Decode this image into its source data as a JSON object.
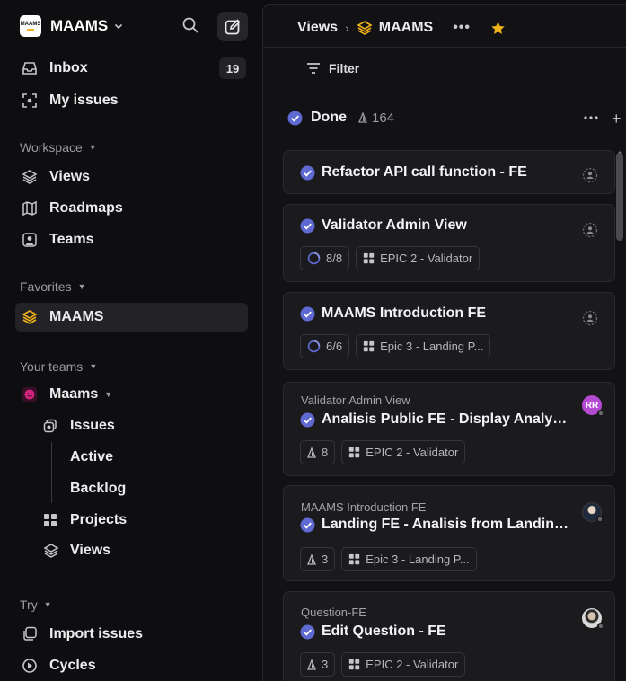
{
  "workspace": {
    "logo_text": "MAAMS",
    "name": "MAAMS"
  },
  "sidebar": {
    "inbox": {
      "label": "Inbox",
      "count": "19"
    },
    "my_issues": {
      "label": "My issues"
    },
    "workspace_section": {
      "label": "Workspace",
      "items": [
        "Views",
        "Roadmaps",
        "Teams"
      ]
    },
    "favorites_section": {
      "label": "Favorites",
      "items": [
        "MAAMS"
      ]
    },
    "teams_section": {
      "label": "Your teams",
      "team": "Maams",
      "items": [
        "Issues",
        "Active",
        "Backlog",
        "Projects",
        "Views"
      ]
    },
    "try_section": {
      "label": "Try",
      "items": [
        "Import issues",
        "Cycles"
      ]
    }
  },
  "header": {
    "breadcrumb_root": "Views",
    "breadcrumb_sep": "›",
    "project": "MAAMS",
    "more": "•••",
    "filter_label": "Filter"
  },
  "column": {
    "title": "Done",
    "count": "164",
    "add": "+"
  },
  "cards": [
    {
      "parent": "",
      "title": "Refactor API call function - FE",
      "chips": []
    },
    {
      "parent": "",
      "title": "Validator Admin View",
      "progress": "8/8",
      "epic": "EPIC 2 - Validator"
    },
    {
      "parent": "",
      "title": "MAAMS Introduction FE",
      "progress": "6/6",
      "epic": "Epic 3 - Landing P..."
    },
    {
      "parent": "Validator Admin View",
      "title": "Analisis Public FE - Display Analysis...",
      "estimate": "8",
      "epic": "EPIC 2 - Validator",
      "avatar_initials": "RR"
    },
    {
      "parent": "MAAMS Introduction FE",
      "title": "Landing FE - Analisis from Landing...",
      "estimate": "3",
      "epic": "Epic 3 - Landing P..."
    },
    {
      "parent": "Question-FE",
      "title": "Edit Question - FE",
      "estimate": "3",
      "epic": "EPIC 2 - Validator"
    }
  ],
  "colors": {
    "accent_done": "#5e6ad2",
    "favorite_star": "#f2b21b",
    "team_icon": "#d6257e",
    "avatar_rr": "#b34ad1"
  },
  "icons": [
    "inbox-icon",
    "target-icon",
    "layers-icon",
    "map-icon",
    "person-icon",
    "grid-icon",
    "import-icon",
    "cycle-icon",
    "filter-icon",
    "star-icon",
    "check-circle-icon",
    "estimate-icon",
    "progress-ring-icon",
    "unassigned-icon"
  ]
}
